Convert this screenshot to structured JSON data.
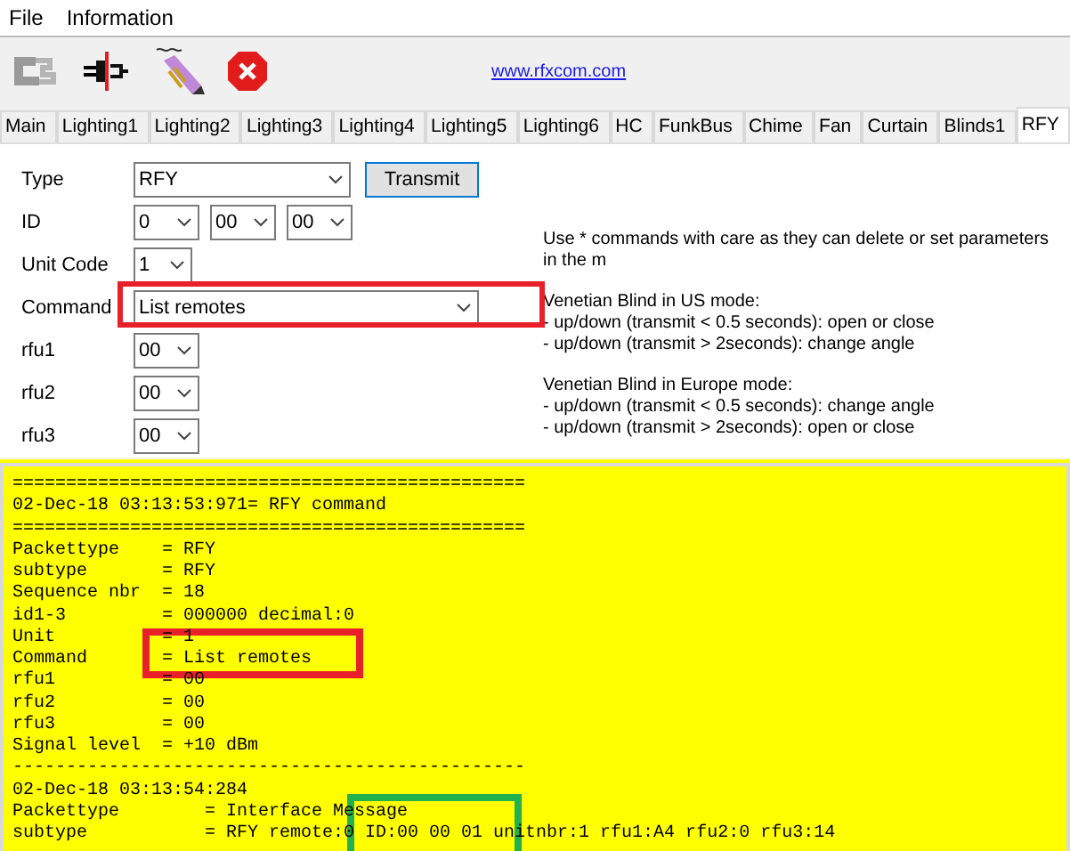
{
  "menu": [
    "File",
    "Information"
  ],
  "toolbar": {
    "link": "www.rfxcom.com"
  },
  "tabs": [
    {
      "label": "Main",
      "selected": false
    },
    {
      "label": "Lighting1",
      "selected": false
    },
    {
      "label": "Lighting2",
      "selected": false
    },
    {
      "label": "Lighting3",
      "selected": false
    },
    {
      "label": "Lighting4",
      "selected": false
    },
    {
      "label": "Lighting5",
      "selected": false
    },
    {
      "label": "Lighting6",
      "selected": false
    },
    {
      "label": "HC",
      "selected": false
    },
    {
      "label": "FunkBus",
      "selected": false
    },
    {
      "label": "Chime",
      "selected": false
    },
    {
      "label": "Fan",
      "selected": false
    },
    {
      "label": "Curtain",
      "selected": false
    },
    {
      "label": "Blinds1",
      "selected": false
    },
    {
      "label": "RFY",
      "selected": true
    }
  ],
  "form": {
    "rows": [
      {
        "label": "Type",
        "fields": [
          {
            "value": "RFY"
          }
        ],
        "button": "Transmit"
      },
      {
        "label": "ID",
        "fields": [
          {
            "value": "0"
          },
          {
            "value": "00"
          },
          {
            "value": "00"
          }
        ]
      },
      {
        "label": "Unit Code",
        "fields": [
          {
            "value": "1"
          }
        ]
      },
      {
        "label": "Command",
        "fields": [
          {
            "value": "List remotes"
          }
        ]
      },
      {
        "label": "rfu1",
        "fields": [
          {
            "value": "00"
          }
        ]
      },
      {
        "label": "rfu2",
        "fields": [
          {
            "value": "00"
          }
        ]
      },
      {
        "label": "rfu3",
        "fields": [
          {
            "value": "00"
          }
        ]
      }
    ],
    "notes": [
      [
        "Use * commands with care as they can delete or set parameters in the m"
      ],
      [
        "Venetian Blind in US mode:",
        "- up/down (transmit < 0.5 seconds): open or close",
        "- up/down (transmit > 2seconds): change angle"
      ],
      [
        "Venetian Blind in Europe mode:",
        "- up/down (transmit < 0.5 seconds): change angle",
        "- up/down (transmit > 2seconds): open or close"
      ]
    ]
  },
  "log": [
    "================================================",
    "02-Dec-18 03:13:53:971= RFY command",
    "================================================",
    "Packettype    = RFY",
    "subtype       = RFY",
    "Sequence nbr  = 18",
    "id1-3         = 000000 decimal:0",
    "Unit          = 1",
    "Command       = List remotes",
    "rfu1          = 00",
    "rfu2          = 00",
    "rfu3          = 00",
    "Signal level  = +10 dBm",
    "------------------------------------------------",
    "02-Dec-18 03:13:54:284",
    "Packettype        = Interface Message",
    "subtype           = RFY remote:0 ID:00 00 01 unitnbr:1 rfu1:A4 rfu2:0 rfu3:14"
  ],
  "annotations": [
    {
      "color": "#e8202a"
    },
    {
      "color": "#e8202a"
    },
    {
      "color": "#22b14c"
    }
  ]
}
